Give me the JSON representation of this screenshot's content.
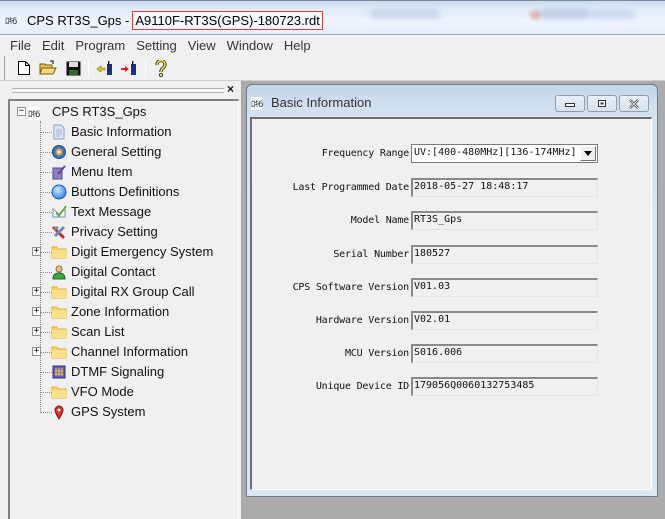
{
  "window": {
    "app_icon_text": "ﾛｷ6",
    "title": "CPS RT3S_Gps -",
    "file_name": "A9110F-RT3S(GPS)-180723.rdt"
  },
  "menu": {
    "items": [
      "File",
      "Edit",
      "Program",
      "Setting",
      "View",
      "Window",
      "Help"
    ]
  },
  "toolbar": {
    "buttons": [
      {
        "name": "new-file",
        "icon": "new-document-icon"
      },
      {
        "name": "open-file",
        "icon": "open-folder-icon"
      },
      {
        "name": "save-file",
        "icon": "save-disk-icon"
      },
      {
        "name": "read-from-radio",
        "icon": "read-radio-icon"
      },
      {
        "name": "write-to-radio",
        "icon": "write-radio-icon"
      },
      {
        "name": "help",
        "icon": "help-icon"
      }
    ]
  },
  "dock": {
    "close_label": "×",
    "tree": {
      "root": {
        "icon_text": "ﾛｷ6",
        "label": "CPS RT3S_Gps",
        "expander": "−"
      },
      "items": [
        {
          "label": "Basic Information",
          "icon": "document-icon",
          "expandable": false
        },
        {
          "label": "General Setting",
          "icon": "gear-icon",
          "expandable": false
        },
        {
          "label": "Menu Item",
          "icon": "menu-item-icon",
          "expandable": false
        },
        {
          "label": "Buttons Definitions",
          "icon": "round-button-icon",
          "expandable": false
        },
        {
          "label": "Text Message",
          "icon": "message-pen-icon",
          "expandable": false
        },
        {
          "label": "Privacy Setting",
          "icon": "privacy-tools-icon",
          "expandable": false
        },
        {
          "label": "Digit Emergency System",
          "icon": "folder-icon",
          "expandable": true
        },
        {
          "label": "Digital Contact",
          "icon": "contact-person-icon",
          "expandable": false
        },
        {
          "label": "Digital RX Group Call",
          "icon": "folder-icon",
          "expandable": true
        },
        {
          "label": "Zone Information",
          "icon": "folder-icon",
          "expandable": true
        },
        {
          "label": "Scan List",
          "icon": "folder-icon",
          "expandable": true
        },
        {
          "label": "Channel Information",
          "icon": "folder-icon",
          "expandable": true
        },
        {
          "label": "DTMF Signaling",
          "icon": "dtmf-keypad-icon",
          "expandable": false
        },
        {
          "label": "VFO Mode",
          "icon": "folder-icon",
          "expandable": false
        },
        {
          "label": "GPS System",
          "icon": "map-pin-icon",
          "expandable": false
        }
      ],
      "expander_plus": "+"
    }
  },
  "basic_info_window": {
    "icon_text": "ﾛｷ6",
    "title": "Basic Information",
    "fields": {
      "frequency_range": {
        "label": "Frequency Range",
        "value": "UV:[400-480MHz][136-174MHz]"
      },
      "last_programmed_date": {
        "label": "Last Programmed Date",
        "value": "2018-05-27 18:48:17"
      },
      "model_name": {
        "label": "Model Name",
        "value": "RT3S_Gps"
      },
      "serial_number": {
        "label": "Serial Number",
        "value": "180527"
      },
      "cps_software_version": {
        "label": "CPS Software Version",
        "value": "V01.03"
      },
      "hardware_version": {
        "label": "Hardware Version",
        "value": "V02.01"
      },
      "mcu_version": {
        "label": "MCU Version",
        "value": "S016.006"
      },
      "unique_device_id": {
        "label": "Unique Device ID",
        "value": "179056Q0060132753485"
      }
    }
  },
  "colors": {
    "file_highlight_border": "#d9423c",
    "window_frame": "#dae7f4",
    "client_bg": "#f0f0f0",
    "mdi_bg": "#ababab"
  }
}
